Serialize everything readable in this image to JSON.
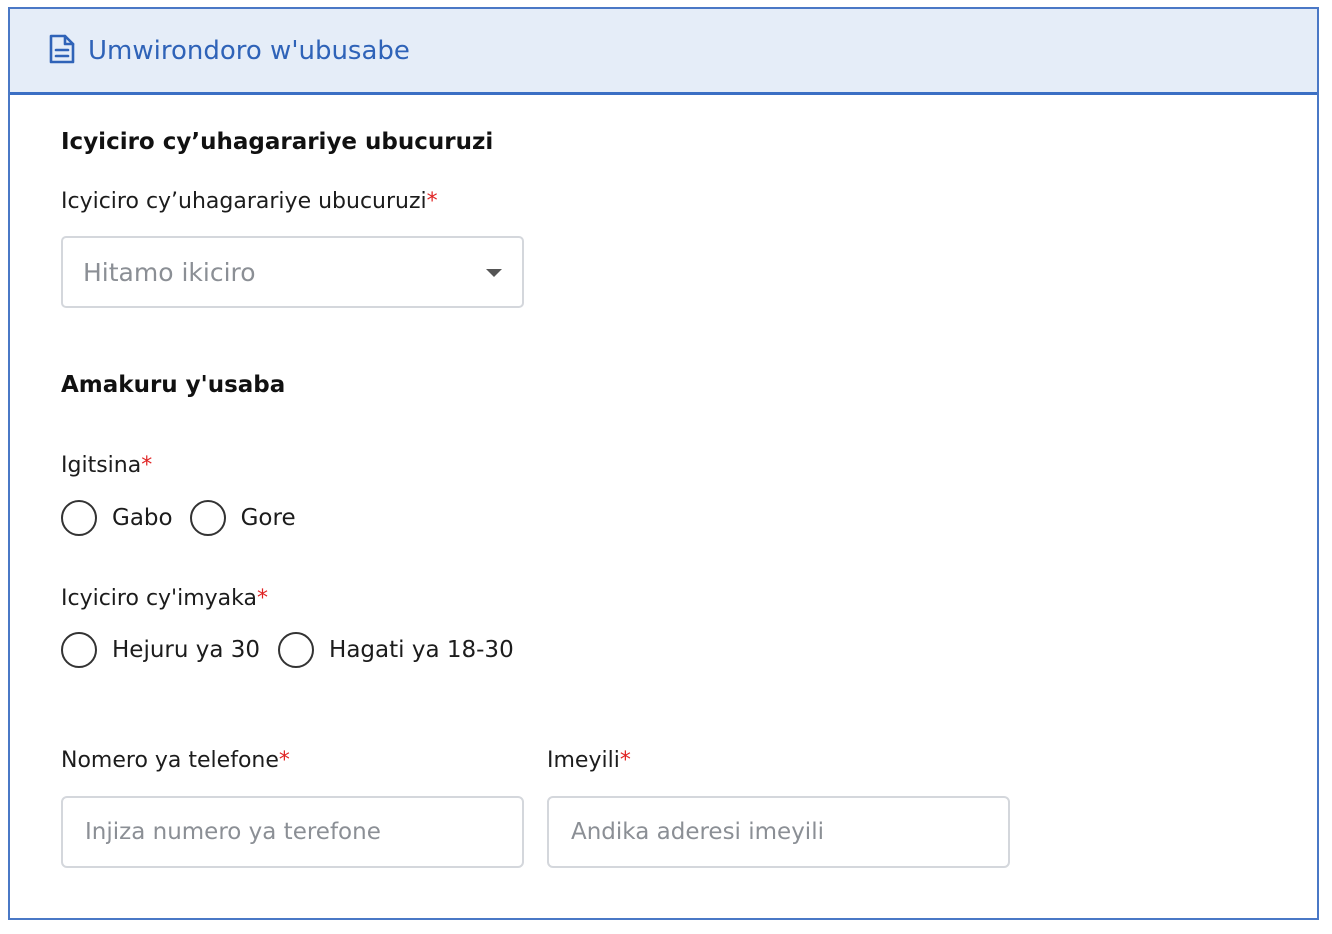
{
  "header": {
    "title": "Umwirondoro w'ubusabe",
    "icon": "document-icon"
  },
  "business_section": {
    "title": "Icyiciro cy’uhagarariye ubucuruzi",
    "field_label": "Icyiciro cy’uhagarariye ubucuruzi",
    "required_mark": "*",
    "select_placeholder": "Hitamo ikiciro"
  },
  "applicant_section": {
    "title": "Amakuru y'usaba",
    "gender": {
      "label": "Igitsina",
      "required_mark": "*",
      "options": [
        "Gabo",
        "Gore"
      ]
    },
    "age": {
      "label": "Icyiciro cy'imyaka",
      "required_mark": "*",
      "options": [
        "Hejuru ya 30",
        "Hagati ya 18-30"
      ]
    },
    "phone": {
      "label": "Nomero ya telefone",
      "required_mark": "*",
      "placeholder": "Injiza numero ya terefone"
    },
    "email": {
      "label": "Imeyili",
      "required_mark": "*",
      "placeholder": "Andika aderesi imeyili"
    }
  },
  "colors": {
    "accent": "#3b6fc4",
    "header_bg": "#e5edf8",
    "required": "#e02424"
  }
}
